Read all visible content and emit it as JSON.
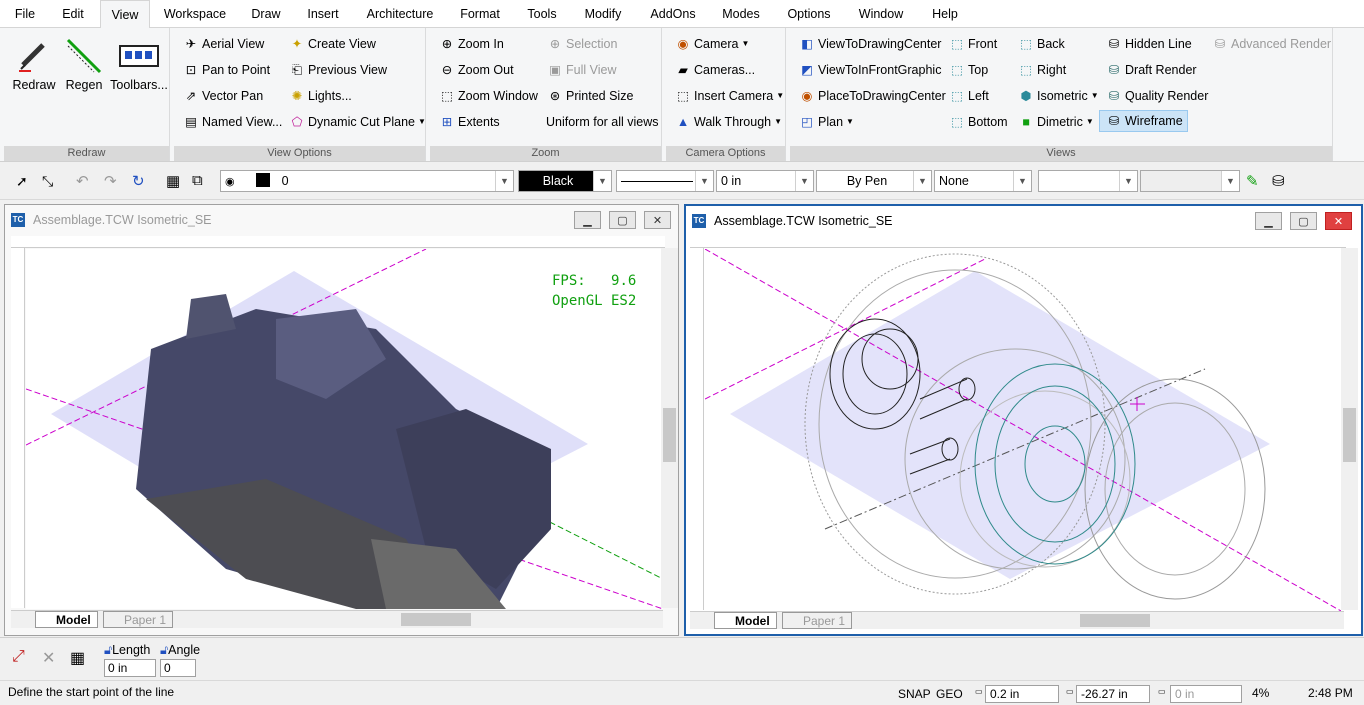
{
  "menubar": {
    "items": [
      "File",
      "Edit",
      "View",
      "Workspace",
      "Draw",
      "Insert",
      "Architecture",
      "Format",
      "Tools",
      "Modify",
      "AddOns",
      "Modes",
      "Options",
      "Window",
      "Help"
    ],
    "active": "View"
  },
  "ribbon": {
    "groups": {
      "redraw": "Redraw",
      "view_options": "View Options",
      "zoom": "Zoom",
      "camera_options": "Camera Options",
      "views": "Views"
    },
    "redraw": {
      "redraw": "Redraw",
      "regen": "Regen",
      "toolbars": "Toolbars..."
    },
    "view_options": {
      "aerial_view": "Aerial View",
      "pan_to_point": "Pan to Point",
      "vector_pan": "Vector Pan",
      "named_view": "Named View...",
      "create_view": "Create View",
      "previous_view": "Previous View",
      "lights": "Lights...",
      "dynamic_cut_plane": "Dynamic Cut Plane"
    },
    "zoom": {
      "zoom_in": "Zoom In",
      "zoom_out": "Zoom Out",
      "zoom_window": "Zoom Window",
      "extents": "Extents",
      "selection": "Selection",
      "full_view": "Full View",
      "printed_size": "Printed Size",
      "uniform": "Uniform for all views"
    },
    "camera": {
      "camera": "Camera",
      "cameras": "Cameras...",
      "insert_camera": "Insert Camera",
      "walk_through": "Walk Through"
    },
    "views": {
      "view_to_drawing_center": "ViewToDrawingCenter",
      "view_in_front_graphic": "ViewToInFrontGraphic",
      "place_to_drawing_center": "PlaceToDrawingCenter",
      "plan": "Plan",
      "front": "Front",
      "top": "Top",
      "left": "Left",
      "bottom": "Bottom",
      "back": "Back",
      "right": "Right",
      "isometric": "Isometric",
      "dimetric": "Dimetric",
      "hidden_line": "Hidden Line",
      "draft_render": "Draft Render",
      "quality_render": "Quality Render",
      "wireframe": "Wireframe",
      "advanced_render": "Advanced Render"
    }
  },
  "property_bar": {
    "layer": "0",
    "color": "Black",
    "line_width": "0 in",
    "pen": "By Pen",
    "fill": "None"
  },
  "left_window": {
    "title": "Assemblage.TCW Isometric_SE",
    "fps_label": "FPS:",
    "fps_value": "9.6",
    "renderer": "OpenGL ES2",
    "tab_model": "Model",
    "tab_paper": "Paper 1"
  },
  "right_window": {
    "title": "Assemblage.TCW Isometric_SE",
    "tab_model": "Model",
    "tab_paper": "Paper 1"
  },
  "input_bar": {
    "length_label": "Length",
    "length_value": "0 in",
    "angle_label": "Angle",
    "angle_value": "0"
  },
  "status": {
    "prompt": "Define the start point of the line",
    "snap": "SNAP",
    "geo": "GEO",
    "x": "0.2 in",
    "y": "-26.27 in",
    "z": "0 in",
    "zoom": "4%",
    "time": "2:48 PM"
  },
  "colors": {
    "accent": "#1e5faa",
    "plane": "#c8c8f5",
    "solid": "#3f4260",
    "wire_teal": "#2f8a8a",
    "axis": "#cc00cc"
  }
}
